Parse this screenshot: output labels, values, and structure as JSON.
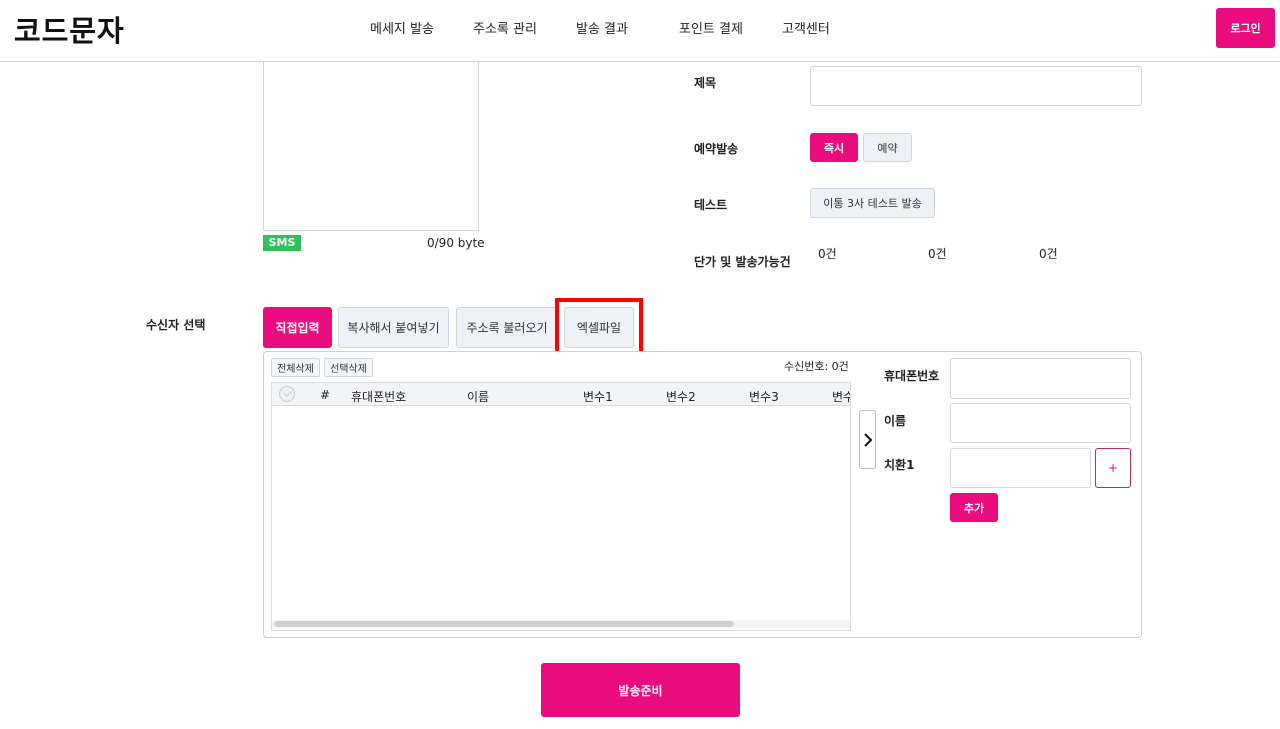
{
  "header": {
    "logo": "코드문자",
    "nav": [
      "메세지 발송",
      "주소록 관리",
      "발송 결과",
      "포인트 결제",
      "고객센터"
    ],
    "login_label": "로그인"
  },
  "message": {
    "type_badge": "SMS",
    "byte_count": "0/90 byte"
  },
  "form": {
    "title_label": "제목",
    "title_value": "",
    "schedule_label": "예약발송",
    "schedule_now": "즉시",
    "schedule_reserve": "예약",
    "test_label": "테스트",
    "test_button": "이통 3사 테스트 발송",
    "cost_label": "단가 및 발송가능건",
    "cost_values": [
      "0건",
      "0건",
      "0건"
    ]
  },
  "recipients": {
    "section_label": "수신자 선택",
    "tabs": [
      "직접입력",
      "복사해서 붙여넣기",
      "주소록 불러오기",
      "엑셀파일"
    ],
    "active_tab": "직접입력",
    "delete_all": "전체삭제",
    "delete_selected": "선택삭제",
    "count_label": "수신번호: 0건",
    "columns": [
      "#",
      "휴대폰번호",
      "이름",
      "변수1",
      "변수2",
      "변수3",
      "변수"
    ],
    "rows": [],
    "side_form": {
      "phone_label": "휴대폰번호",
      "phone_value": "",
      "name_label": "이름",
      "name_value": "",
      "var_label": "치환1",
      "var_value": "",
      "plus_label": "+",
      "add_label": "추가"
    }
  },
  "submit_label": "발송준비",
  "colors": {
    "accent": "#ea0b7e",
    "sms_badge": "#2fc25b",
    "highlight": "#ff0000"
  },
  "icons": [
    "check-circle-icon",
    "chevron-right-icon"
  ]
}
